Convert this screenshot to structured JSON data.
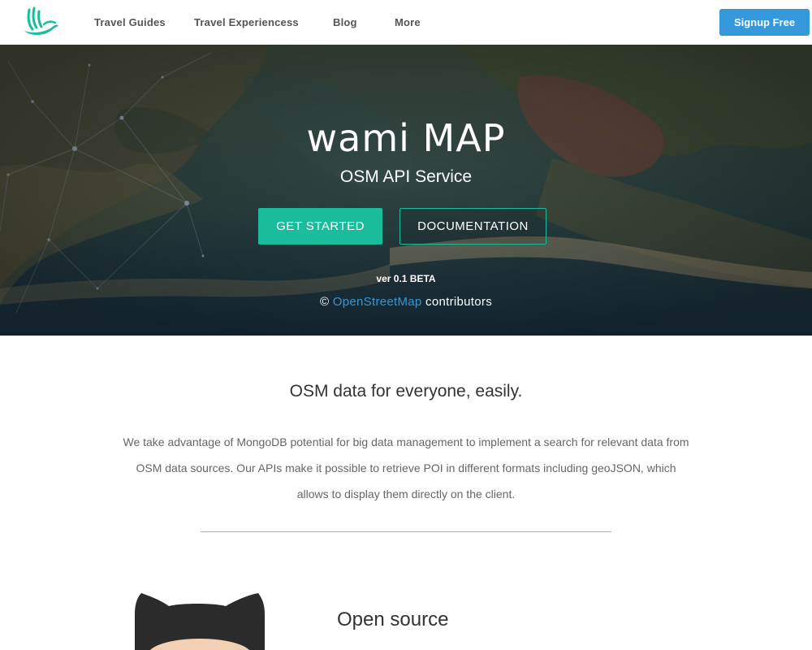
{
  "nav": {
    "logo_icon": "bird-logo-icon",
    "links": [
      "Travel Guides",
      "Travel Experiencess",
      "Blog",
      "More"
    ],
    "signup_label": "Signup Free"
  },
  "hero": {
    "title": "wami MAP",
    "subtitle": "OSM API Service",
    "get_started_label": "GET STARTED",
    "documentation_label": "DOCUMENTATION",
    "version": "ver 0.1 BETA",
    "credit_symbol": "©",
    "credit_link": "OpenStreetMap",
    "credit_suffix": "contributors"
  },
  "intro": {
    "title": "OSM data for everyone, easily.",
    "text": "We take advantage of MongoDB potential for big data management to implement a search for relevant data from OSM data sources. Our APIs make it possible to retrieve POI in different formats including geoJSON, which allows to display them directly on the client."
  },
  "feature": {
    "icon": "github-octocat-icon",
    "title": "Open source"
  },
  "colors": {
    "accent": "#1abc9c",
    "signup": "#3498db",
    "link": "#3498db"
  }
}
